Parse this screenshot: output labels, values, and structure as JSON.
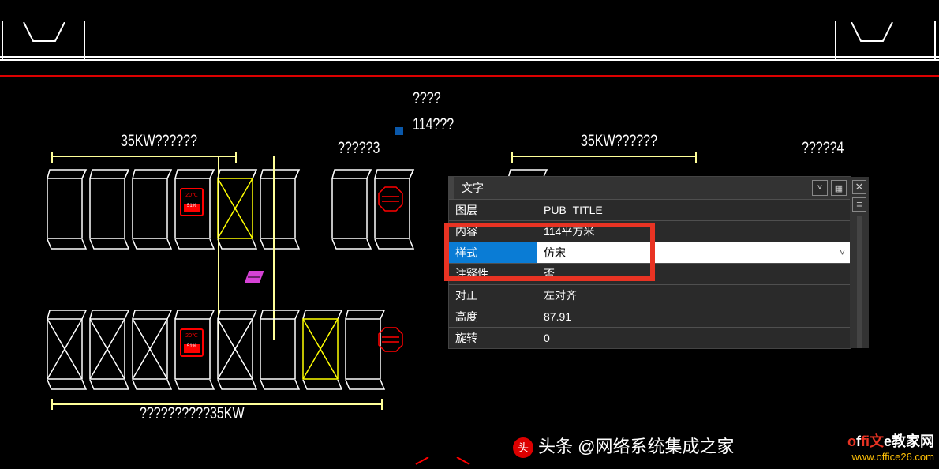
{
  "text": {
    "center_top": "????",
    "center_mid": "114???",
    "label_left_top": "35KW??????",
    "label_col3": "?????3",
    "label_right_top": "35KW??????",
    "label_col4": "?????4",
    "bottom_row_label": "??????????35KW"
  },
  "palette": {
    "title": "文字",
    "rows": [
      {
        "k": "图层",
        "v": "PUB_TITLE"
      },
      {
        "k": "内容",
        "v": "114平方米"
      },
      {
        "k": "样式",
        "v": "仿宋"
      },
      {
        "k": "注释性",
        "v": "否"
      },
      {
        "k": "对正",
        "v": "左对齐"
      },
      {
        "k": "高度",
        "v": "87.91"
      },
      {
        "k": "旋转",
        "v": "0"
      }
    ],
    "selected": 2
  },
  "watermark": {
    "t1_prefix": "头条",
    "t1_handle": "@网络系统集成之家",
    "t2_line1_a": "of",
    "t2_line1_b": "fi文",
    "t2_line1_c": "e教家网",
    "t2_line2": "www.office26.com"
  }
}
